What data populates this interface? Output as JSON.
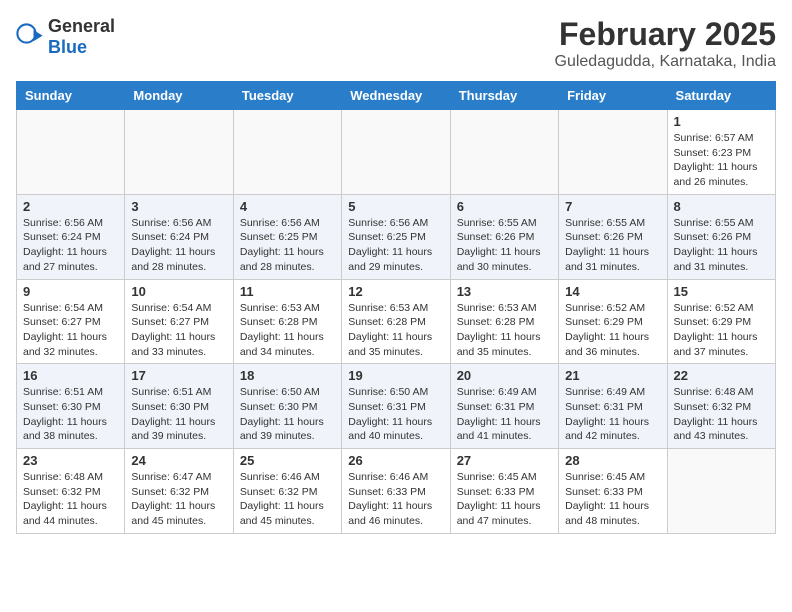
{
  "logo": {
    "general": "General",
    "blue": "Blue"
  },
  "title": "February 2025",
  "subtitle": "Guledagudda, Karnataka, India",
  "weekdays": [
    "Sunday",
    "Monday",
    "Tuesday",
    "Wednesday",
    "Thursday",
    "Friday",
    "Saturday"
  ],
  "weeks": [
    [
      {
        "day": "",
        "info": ""
      },
      {
        "day": "",
        "info": ""
      },
      {
        "day": "",
        "info": ""
      },
      {
        "day": "",
        "info": ""
      },
      {
        "day": "",
        "info": ""
      },
      {
        "day": "",
        "info": ""
      },
      {
        "day": "1",
        "info": "Sunrise: 6:57 AM\nSunset: 6:23 PM\nDaylight: 11 hours and 26 minutes."
      }
    ],
    [
      {
        "day": "2",
        "info": "Sunrise: 6:56 AM\nSunset: 6:24 PM\nDaylight: 11 hours and 27 minutes."
      },
      {
        "day": "3",
        "info": "Sunrise: 6:56 AM\nSunset: 6:24 PM\nDaylight: 11 hours and 28 minutes."
      },
      {
        "day": "4",
        "info": "Sunrise: 6:56 AM\nSunset: 6:25 PM\nDaylight: 11 hours and 28 minutes."
      },
      {
        "day": "5",
        "info": "Sunrise: 6:56 AM\nSunset: 6:25 PM\nDaylight: 11 hours and 29 minutes."
      },
      {
        "day": "6",
        "info": "Sunrise: 6:55 AM\nSunset: 6:26 PM\nDaylight: 11 hours and 30 minutes."
      },
      {
        "day": "7",
        "info": "Sunrise: 6:55 AM\nSunset: 6:26 PM\nDaylight: 11 hours and 31 minutes."
      },
      {
        "day": "8",
        "info": "Sunrise: 6:55 AM\nSunset: 6:26 PM\nDaylight: 11 hours and 31 minutes."
      }
    ],
    [
      {
        "day": "9",
        "info": "Sunrise: 6:54 AM\nSunset: 6:27 PM\nDaylight: 11 hours and 32 minutes."
      },
      {
        "day": "10",
        "info": "Sunrise: 6:54 AM\nSunset: 6:27 PM\nDaylight: 11 hours and 33 minutes."
      },
      {
        "day": "11",
        "info": "Sunrise: 6:53 AM\nSunset: 6:28 PM\nDaylight: 11 hours and 34 minutes."
      },
      {
        "day": "12",
        "info": "Sunrise: 6:53 AM\nSunset: 6:28 PM\nDaylight: 11 hours and 35 minutes."
      },
      {
        "day": "13",
        "info": "Sunrise: 6:53 AM\nSunset: 6:28 PM\nDaylight: 11 hours and 35 minutes."
      },
      {
        "day": "14",
        "info": "Sunrise: 6:52 AM\nSunset: 6:29 PM\nDaylight: 11 hours and 36 minutes."
      },
      {
        "day": "15",
        "info": "Sunrise: 6:52 AM\nSunset: 6:29 PM\nDaylight: 11 hours and 37 minutes."
      }
    ],
    [
      {
        "day": "16",
        "info": "Sunrise: 6:51 AM\nSunset: 6:30 PM\nDaylight: 11 hours and 38 minutes."
      },
      {
        "day": "17",
        "info": "Sunrise: 6:51 AM\nSunset: 6:30 PM\nDaylight: 11 hours and 39 minutes."
      },
      {
        "day": "18",
        "info": "Sunrise: 6:50 AM\nSunset: 6:30 PM\nDaylight: 11 hours and 39 minutes."
      },
      {
        "day": "19",
        "info": "Sunrise: 6:50 AM\nSunset: 6:31 PM\nDaylight: 11 hours and 40 minutes."
      },
      {
        "day": "20",
        "info": "Sunrise: 6:49 AM\nSunset: 6:31 PM\nDaylight: 11 hours and 41 minutes."
      },
      {
        "day": "21",
        "info": "Sunrise: 6:49 AM\nSunset: 6:31 PM\nDaylight: 11 hours and 42 minutes."
      },
      {
        "day": "22",
        "info": "Sunrise: 6:48 AM\nSunset: 6:32 PM\nDaylight: 11 hours and 43 minutes."
      }
    ],
    [
      {
        "day": "23",
        "info": "Sunrise: 6:48 AM\nSunset: 6:32 PM\nDaylight: 11 hours and 44 minutes."
      },
      {
        "day": "24",
        "info": "Sunrise: 6:47 AM\nSunset: 6:32 PM\nDaylight: 11 hours and 45 minutes."
      },
      {
        "day": "25",
        "info": "Sunrise: 6:46 AM\nSunset: 6:32 PM\nDaylight: 11 hours and 45 minutes."
      },
      {
        "day": "26",
        "info": "Sunrise: 6:46 AM\nSunset: 6:33 PM\nDaylight: 11 hours and 46 minutes."
      },
      {
        "day": "27",
        "info": "Sunrise: 6:45 AM\nSunset: 6:33 PM\nDaylight: 11 hours and 47 minutes."
      },
      {
        "day": "28",
        "info": "Sunrise: 6:45 AM\nSunset: 6:33 PM\nDaylight: 11 hours and 48 minutes."
      },
      {
        "day": "",
        "info": ""
      }
    ]
  ]
}
